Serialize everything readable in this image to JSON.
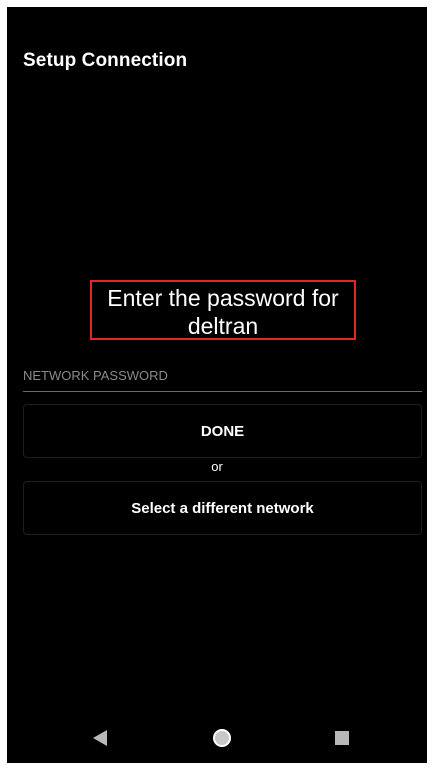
{
  "header": {
    "title": "Setup Connection"
  },
  "prompt": {
    "line1": "Enter the password for",
    "line2": "deltran"
  },
  "password_field": {
    "placeholder": "NETWORK PASSWORD",
    "value": ""
  },
  "actions": {
    "done_label": "DONE",
    "or_label": "or",
    "select_network_label": "Select a different network"
  },
  "navigation": {
    "back_icon": "back-triangle-icon",
    "home_icon": "home-circle-icon",
    "recents_icon": "recents-square-icon"
  },
  "colors": {
    "background": "#000000",
    "text": "#ffffff",
    "highlight_border": "#e3242b"
  }
}
